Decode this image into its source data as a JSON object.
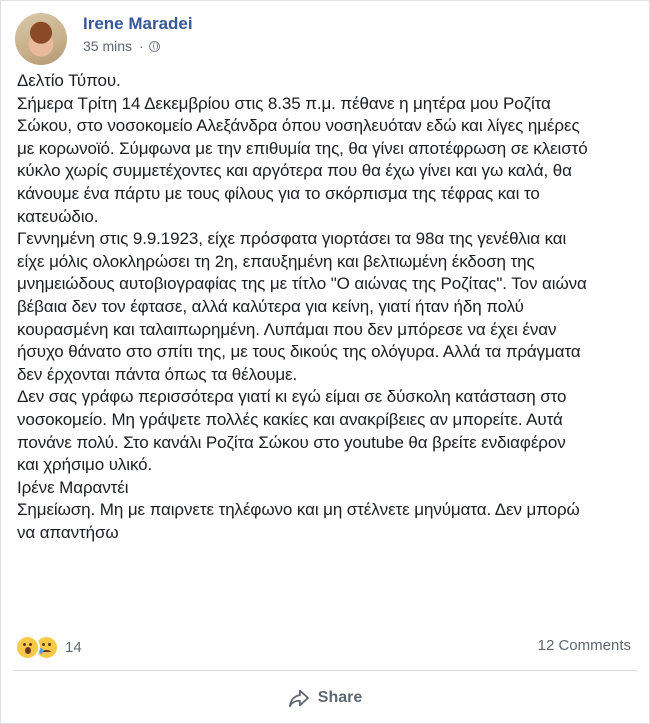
{
  "post": {
    "author": "Irene Maradei",
    "time": "35 mins",
    "separator": "·",
    "privacy_icon": "globe-icon",
    "body_lines": [
      "Δελτίο Τύπου.",
      "Σήμερα Τρίτη 14 Δεκεμβρίου στις 8.35 π.μ. πέθανε η μητέρα μου Ροζίτα",
      "Σώκου, στο νοσοκομείο Αλεξάνδρα όπου νοσηλευόταν εδώ και λίγες ημέρες",
      "με κορωνοϊό. Σύμφωνα με την επιθυμία της, θα γίνει αποτέφρωση σε κλειστό",
      "κύκλο χωρίς συμμετέχοντες και αργότερα που θα έχω γίνει και γω καλά, θα",
      "κάνουμε ένα πάρτυ με τους φίλους για το σκόρπισμα της τέφρας και το",
      "κατευώδιο.",
      "Γεννημένη στις 9.9.1923, είχε πρόσφατα γιορτάσει τα 98α της γενέθλια και",
      "είχε μόλις ολοκληρώσει τη 2η, επαυξημένη και βελτιωμένη έκδοση της",
      "μνημειώδους αυτοβιογραφίας της με τίτλο \"Ο αιώνας της Ροζίτας\". Τον αιώνα",
      "βέβαια δεν τον έφτασε, αλλά καλύτερα για κείνη, γιατί ήταν ήδη πολύ",
      "κουρασμένη και ταλαιπωρημένη. Λυπάμαι που δεν μπόρεσε να έχει έναν",
      "ήσυχο θάνατο στο σπίτι της, με τους δικούς της ολόγυρα. Αλλά τα πράγματα",
      "δεν έρχονται πάντα όπως τα θέλουμε.",
      "Δεν σας γράφω περισσότερα γιατί κι εγώ είμαι σε δύσκολη κατάσταση στο",
      "νοσοκομείο. Μη γράψετε πολλές κακίες και ανακρίβειες αν μπορείτε. Αυτά",
      "πονάνε πολύ. Στο κανάλι Ροζίτα Σώκου στο youtube θα βρείτε ενδιαφέρον",
      "και χρήσιμο υλικό.",
      "Ιρένε Μαραντέι",
      "Σημείωση. Μη με παιρνετε τηλέφωνο και μη στέλνετε μηνύματα. Δεν μπορώ",
      "να απαντήσω"
    ]
  },
  "footer": {
    "reaction_icons": [
      "wow-reaction-icon",
      "sad-reaction-icon"
    ],
    "reaction_count": "14",
    "comments": "12 Comments",
    "share_label": "Share"
  },
  "colors": {
    "author": "#385898",
    "muted": "#606770",
    "divider": "#dadde1"
  }
}
